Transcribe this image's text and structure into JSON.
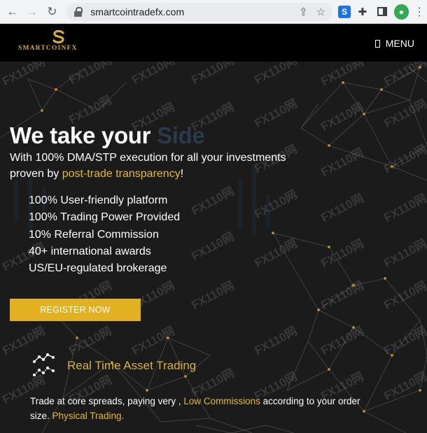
{
  "browser": {
    "url": "smartcointradefx.com"
  },
  "header": {
    "logo_text": "SMARTCOINFX",
    "menu_label": "MENU"
  },
  "hero": {
    "headline_main": "We take your",
    "headline_accent": "Side",
    "subtitle_part1": "With 100% DMA/STP execution for all your investments proven by ",
    "subtitle_link": "post-trade transparency",
    "subtitle_end": "!",
    "features": [
      "100% User-friendly platform",
      "100% Trading Power Provided",
      "10% Referral Commission",
      "40+ international awards",
      "US/EU-regulated brokerage"
    ],
    "register_label": "REGISTER NOW"
  },
  "section": {
    "title": "Real Time Asset Trading",
    "text_part1": "Trade at core spreads, paying very , ",
    "text_link1": "Low Commissions",
    "text_part2": " according to your order size. ",
    "text_link2": "Physical Trading."
  },
  "watermark": "FX110网",
  "colors": {
    "accent_gold": "#e2b122",
    "link_gold": "#e8b936",
    "background": "#1b1b1b",
    "header": "#000000"
  }
}
